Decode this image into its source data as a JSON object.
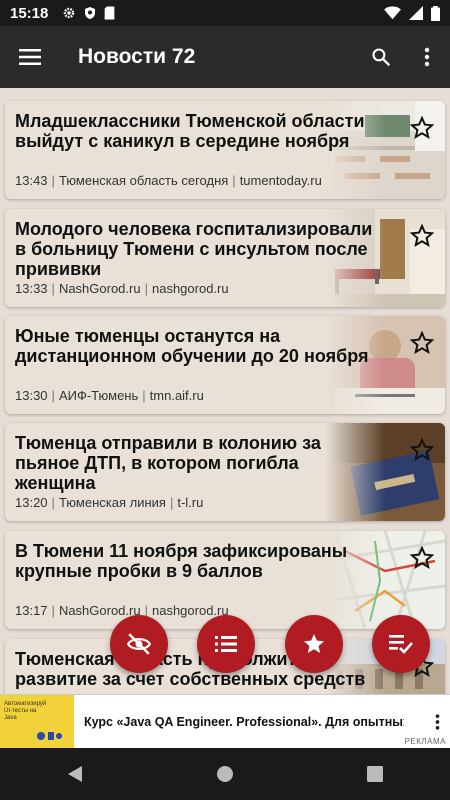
{
  "status_bar": {
    "time": "15:18"
  },
  "app_bar": {
    "title": "Новости 72"
  },
  "articles": [
    {
      "title": "Младшеклассники Тюменской области выйдут с каникул в середине ноября",
      "time": "13:43",
      "source": "Тюменская область сегодня",
      "domain": "tumentoday.ru"
    },
    {
      "title": "Молодого человека госпитализировали в больницу Тюмени с инсультом после прививки",
      "time": "13:33",
      "source": "NashGorod.ru",
      "domain": "nashgorod.ru"
    },
    {
      "title": "Юные тюменцы останутся на дистанционном обучении до 20 ноября",
      "time": "13:30",
      "source": "АИФ-Тюмень",
      "domain": "tmn.aif.ru"
    },
    {
      "title": "Тюменца отправили в колонию за пьяное ДТП, в котором погибла женщина",
      "time": "13:20",
      "source": "Тюменская линия",
      "domain": "t-l.ru"
    },
    {
      "title": "В Тюмени 11 ноября зафиксированы крупные пробки в 9 баллов",
      "time": "13:17",
      "source": "NashGorod.ru",
      "domain": "nashgorod.ru"
    },
    {
      "title": "Тюменская область продолжит развитие за счет собственных средств",
      "time": "",
      "source": "",
      "domain": ""
    }
  ],
  "ad": {
    "thumb_text": "Автоматизируй UI-тесты на Java",
    "text": "Курс «Java QA Engineer. Professional». Для опытных",
    "label": "РЕКЛАМА"
  },
  "colors": {
    "accent": "#b01c22",
    "app_bar": "#2b2b2b",
    "card_bg": "#e9e1d8"
  }
}
